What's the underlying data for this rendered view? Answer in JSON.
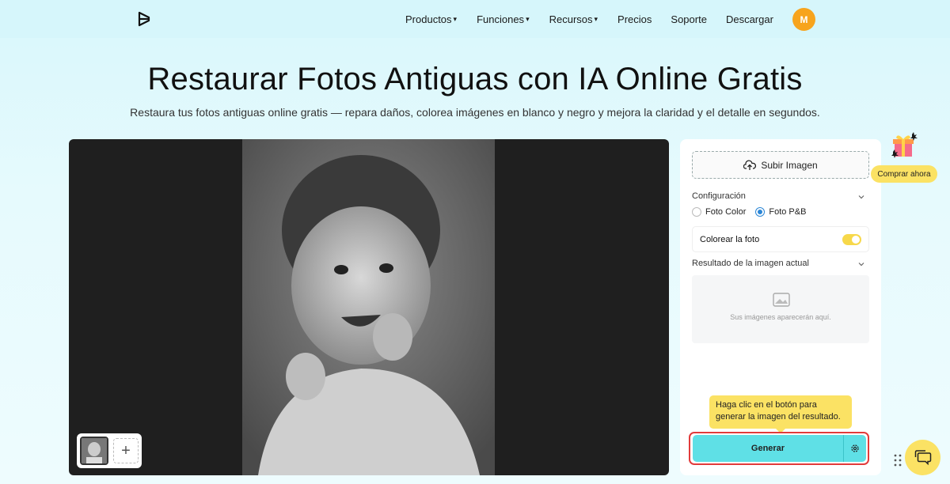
{
  "nav": {
    "logo_icon": "brand-logo-icon",
    "items": [
      {
        "label": "Productos",
        "has_caret": true
      },
      {
        "label": "Funciones",
        "has_caret": true
      },
      {
        "label": "Recursos",
        "has_caret": true
      },
      {
        "label": "Precios",
        "has_caret": false
      },
      {
        "label": "Soporte",
        "has_caret": false
      },
      {
        "label": "Descargar",
        "has_caret": false
      }
    ],
    "caret": "▾",
    "avatar_initial": "M",
    "avatar_color": "#f7a41d"
  },
  "hero": {
    "title": "Restaurar Fotos Antiguas con IA Online Gratis",
    "subtitle": "Restaura tus fotos antiguas online gratis — repara daños, colorea imágenes en blanco y negro y mejora la claridad y el detalle en segundos."
  },
  "canvas": {
    "add_label": "+"
  },
  "panel": {
    "upload_label": "Subir Imagen",
    "config_label": "Configuración",
    "radio_options": [
      {
        "label": "Foto Color",
        "selected": false
      },
      {
        "label": "Foto P&B",
        "selected": true
      }
    ],
    "colorize_label": "Colorear la foto",
    "colorize_on": true,
    "result_label": "Resultado de la imagen actual",
    "result_placeholder": "Sus imágenes aparecerán aquí.",
    "tooltip": "Haga clic en el botón para generar la imagen del resultado.",
    "generate_label": "Generar"
  },
  "floating": {
    "buy_label": "Comprar ahora"
  },
  "colors": {
    "accent_cyan": "#5fe0e6",
    "accent_yellow": "#fbe264",
    "highlight_red": "#e23b3b"
  }
}
